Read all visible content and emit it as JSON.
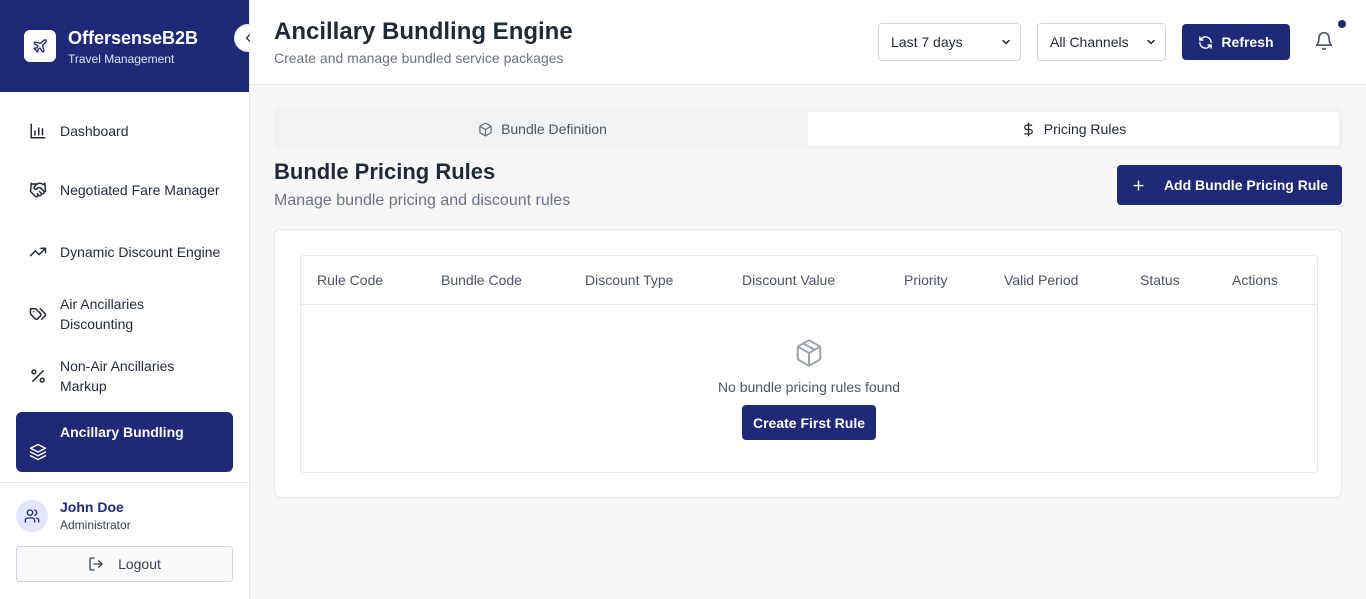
{
  "brand": {
    "name": "OffersenseB2B",
    "subtitle": "Travel Management"
  },
  "sidebar": {
    "items": [
      {
        "label": "Dashboard",
        "icon": "bar-chart-icon"
      },
      {
        "label": "Negotiated Fare Manager",
        "icon": "handshake-icon"
      },
      {
        "label": "Dynamic Discount Engine",
        "icon": "trending-up-icon"
      },
      {
        "label": "Air Ancillaries Discounting",
        "icon": "tags-icon"
      },
      {
        "label": "Non-Air Ancillaries Markup",
        "icon": "percent-icon"
      },
      {
        "label": "Ancillary Bundling",
        "icon": "layers-icon",
        "active": true
      }
    ]
  },
  "user": {
    "name": "John Doe",
    "role": "Administrator",
    "logout_label": "Logout"
  },
  "header": {
    "title": "Ancillary Bundling Engine",
    "subtitle": "Create and manage bundled service packages",
    "date_range": "Last 7 days",
    "channel": "All Channels",
    "refresh_label": "Refresh"
  },
  "tabs": [
    {
      "label": "Bundle Definition",
      "icon": "box-icon",
      "active": false
    },
    {
      "label": "Pricing Rules",
      "icon": "dollar-icon",
      "active": true
    }
  ],
  "section": {
    "title": "Bundle Pricing Rules",
    "subtitle": "Manage bundle pricing and discount rules",
    "add_label": "Add Bundle Pricing Rule"
  },
  "table": {
    "columns": [
      "Rule Code",
      "Bundle Code",
      "Discount Type",
      "Discount Value",
      "Priority",
      "Valid Period",
      "Status",
      "Actions"
    ],
    "empty_text": "No bundle pricing rules found",
    "create_label": "Create First Rule"
  },
  "colors": {
    "primary": "#1e2a78",
    "background": "#f7f7f8",
    "border": "#e5e7eb"
  }
}
